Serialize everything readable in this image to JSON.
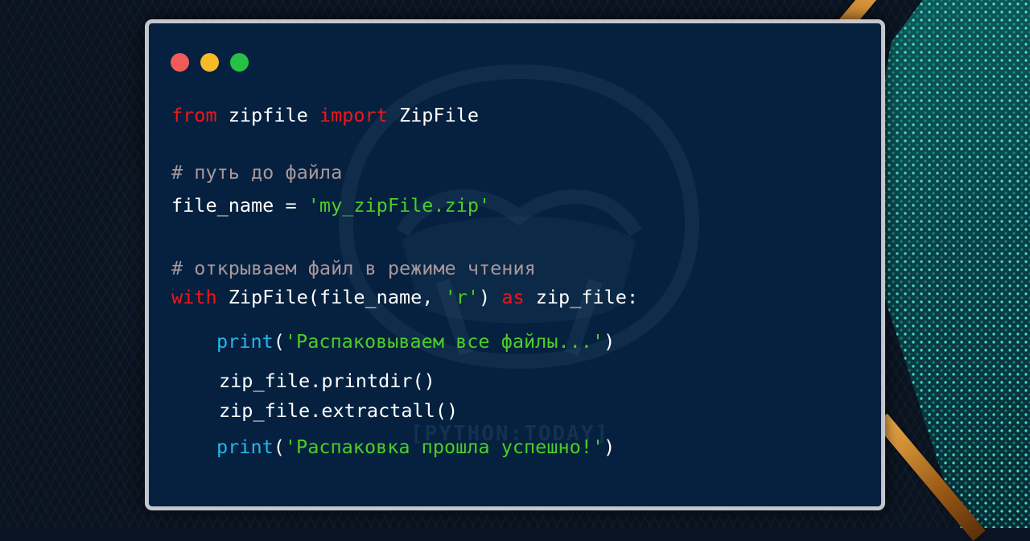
{
  "colors": {
    "keyword": "#f0161c",
    "string": "#4ccd26",
    "comment": "#a9969a",
    "builtin": "#23b6ee",
    "text": "#ffffff",
    "window_bg": "#05213f",
    "window_border": "#c3c6cb",
    "dot_red": "#f25a57",
    "dot_yellow": "#f4bb27",
    "dot_green": "#26c043"
  },
  "window": {
    "controls": [
      "close-dot",
      "minimize-dot",
      "maximize-dot"
    ],
    "watermark_text": "[PYTHON:TODAY]"
  },
  "code": {
    "line1": {
      "kw1": "from",
      "mod": " zipfile ",
      "kw2": "import",
      "name": " ZipFile"
    },
    "line2": {
      "comment": "# путь до файла"
    },
    "line3": {
      "lhs": "file_name = ",
      "str": "'my_zipFile.zip'"
    },
    "line4": {
      "comment": "# открываем файл в режиме чтения"
    },
    "line5": {
      "kw": "with",
      "call": " ZipFile(file_name, ",
      "str": "'r'",
      "close": ") ",
      "kw2": "as",
      "target": " zip_file:"
    },
    "line6": {
      "fn": "print",
      "open": "(",
      "str": "'Распаковываем все файлы...'",
      "close": ")"
    },
    "line7": {
      "text": "zip_file.printdir()"
    },
    "line8": {
      "text": "zip_file.extractall()"
    },
    "line9": {
      "fn": "print",
      "open": "(",
      "str": "'Распаковка прошла успешно!'",
      "close": ")"
    }
  }
}
